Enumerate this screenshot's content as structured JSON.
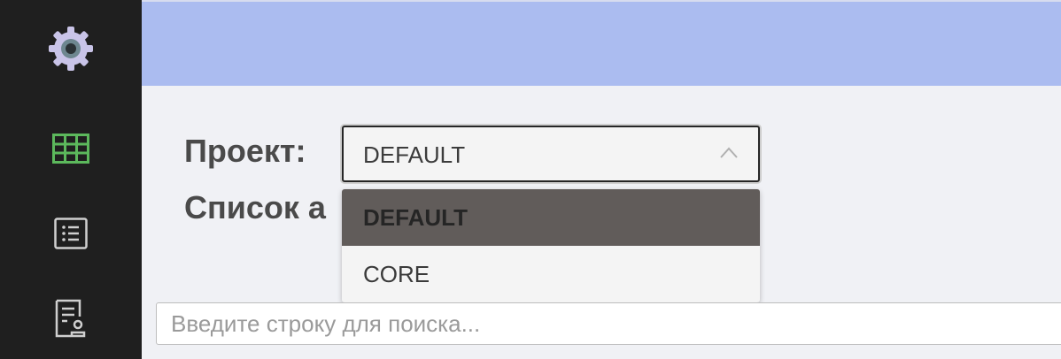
{
  "sidebar": {
    "items": [
      {
        "icon": "gear-icon"
      },
      {
        "icon": "table-grid-icon",
        "active": true,
        "color": "#5cb85c"
      },
      {
        "icon": "list-icon"
      },
      {
        "icon": "document-user-icon"
      }
    ]
  },
  "colors": {
    "sidebar_bg": "#1f1f1f",
    "topbar_bg": "#abbcf0",
    "main_bg": "#f0f1f5",
    "active_icon": "#5cb85c",
    "selected_option_bg": "#615c5a"
  },
  "project": {
    "label": "Проект:",
    "selected": "DEFAULT",
    "options": [
      "DEFAULT",
      "CORE"
    ]
  },
  "list_heading": {
    "label": "Список а"
  },
  "search": {
    "placeholder": "Введите строку для поиска...",
    "value": ""
  }
}
